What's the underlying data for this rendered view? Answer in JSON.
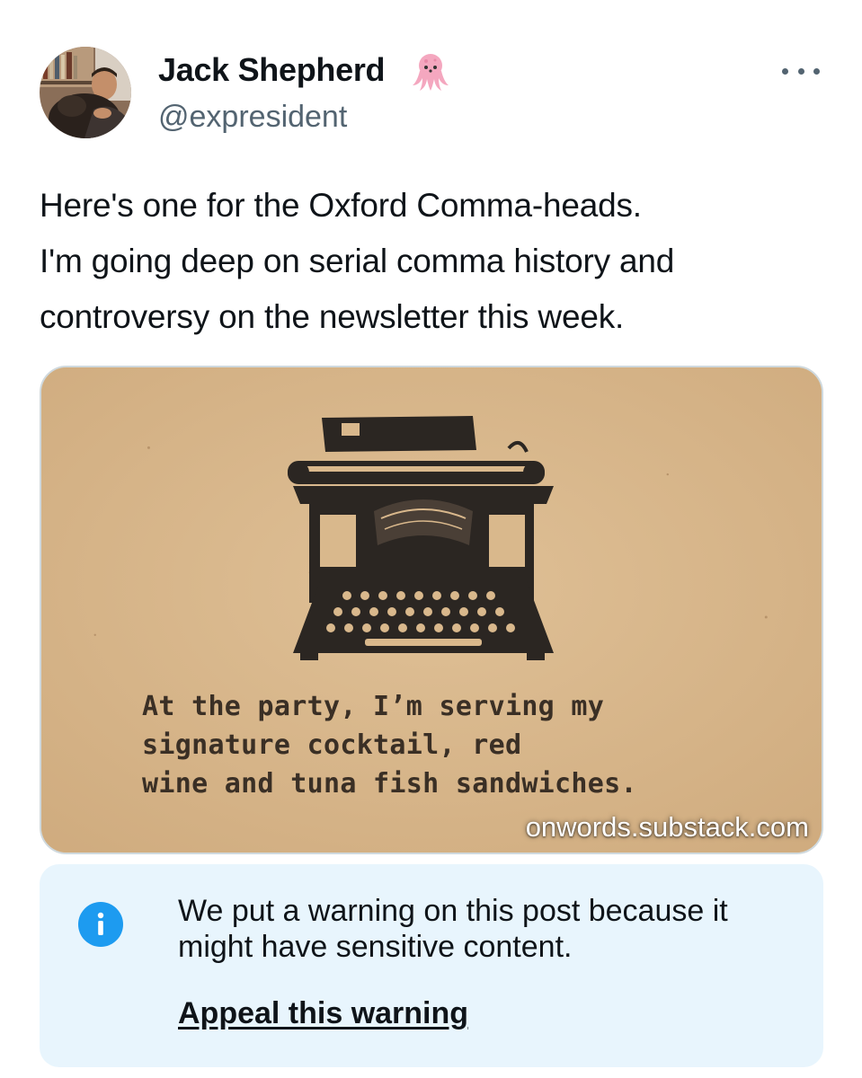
{
  "author": {
    "display_name": "Jack Shepherd",
    "handle": "@expresident",
    "badge_icon": "octopus-emoji-icon",
    "avatar_icon": "profile-photo"
  },
  "post": {
    "text_lines": [
      "Here's one for the Oxford Comma-heads.",
      "I'm going deep on serial comma history and",
      "controversy on the newsletter this week."
    ]
  },
  "card": {
    "caption_lines": [
      "At the party, I’m serving my",
      "signature cocktail, red",
      "wine and tuna fish sandwiches."
    ],
    "domain": "onwords.substack.com",
    "image_icon": "typewriter-illustration"
  },
  "warning": {
    "icon": "info-icon",
    "text_lines": [
      "We put a warning on this post because it",
      "might have sensitive content."
    ],
    "appeal_label": "Appeal this warning"
  },
  "colors": {
    "text_primary": "#0f1419",
    "text_secondary": "#536471",
    "accent": "#1d9bf0",
    "warning_bg": "#e8f5fd",
    "card_paper": "#d9b88c"
  }
}
